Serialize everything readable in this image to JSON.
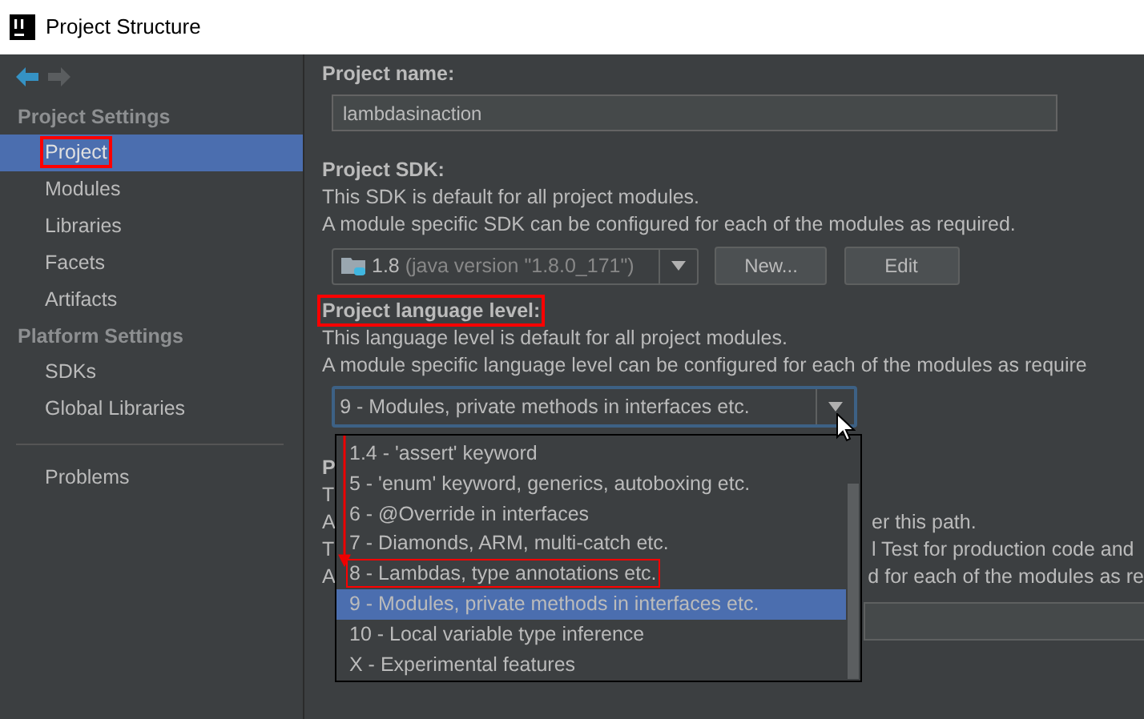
{
  "window": {
    "title": "Project Structure"
  },
  "sidebar": {
    "sections": [
      {
        "title": "Project Settings",
        "items": [
          {
            "label": "Project",
            "selected": true,
            "highlighted": true
          },
          {
            "label": "Modules",
            "selected": false,
            "highlighted": false
          },
          {
            "label": "Libraries",
            "selected": false,
            "highlighted": false
          },
          {
            "label": "Facets",
            "selected": false,
            "highlighted": false
          },
          {
            "label": "Artifacts",
            "selected": false,
            "highlighted": false
          }
        ]
      },
      {
        "title": "Platform Settings",
        "items": [
          {
            "label": "SDKs",
            "selected": false,
            "highlighted": false
          },
          {
            "label": "Global Libraries",
            "selected": false,
            "highlighted": false
          }
        ]
      }
    ],
    "footer_items": [
      {
        "label": "Problems",
        "selected": false,
        "highlighted": false
      }
    ]
  },
  "project_name": {
    "label": "Project name:",
    "value": "lambdasinaction"
  },
  "project_sdk": {
    "label": "Project SDK:",
    "description": [
      "This SDK is default for all project modules.",
      "A module specific SDK can be configured for each of the modules as required."
    ],
    "combo": {
      "version": "1.8",
      "detail": "(java version \"1.8.0_171\")"
    },
    "buttons": [
      "New...",
      "Edit"
    ]
  },
  "language_level": {
    "label": "Project language level:",
    "highlighted": true,
    "description": [
      "This language level is default for all project modules.",
      "A module specific language level can be configured for each of the modules as require"
    ],
    "combo": {
      "value": "9 - Modules, private methods in interfaces etc."
    },
    "dropdown": {
      "expanded": true,
      "options": [
        {
          "label": "1.4 - 'assert' keyword",
          "selected": false,
          "highlighted": false
        },
        {
          "label": "5 - 'enum' keyword, generics, autoboxing etc.",
          "selected": false,
          "highlighted": false
        },
        {
          "label": "6 - @Override in interfaces",
          "selected": false,
          "highlighted": false
        },
        {
          "label": "7 - Diamonds, ARM, multi-catch etc.",
          "selected": false,
          "highlighted": false
        },
        {
          "label": "8 - Lambdas, type annotations etc.",
          "selected": false,
          "highlighted": true
        },
        {
          "label": "9 - Modules, private methods in interfaces etc.",
          "selected": true,
          "highlighted": false
        },
        {
          "label": "10 - Local variable type inference",
          "selected": false,
          "highlighted": false
        },
        {
          "label": "X - Experimental features",
          "selected": false,
          "highlighted": false
        }
      ]
    }
  },
  "obscured_section": {
    "rows": [
      {
        "kind": "heading",
        "left": "P"
      },
      {
        "kind": "text",
        "left": "T"
      },
      {
        "kind": "text",
        "left": "A",
        "right": "er this path."
      },
      {
        "kind": "text",
        "left": "T",
        "right": "l Test for production code and"
      },
      {
        "kind": "text",
        "left": "A",
        "right": "d for each of the modules as re"
      }
    ]
  }
}
